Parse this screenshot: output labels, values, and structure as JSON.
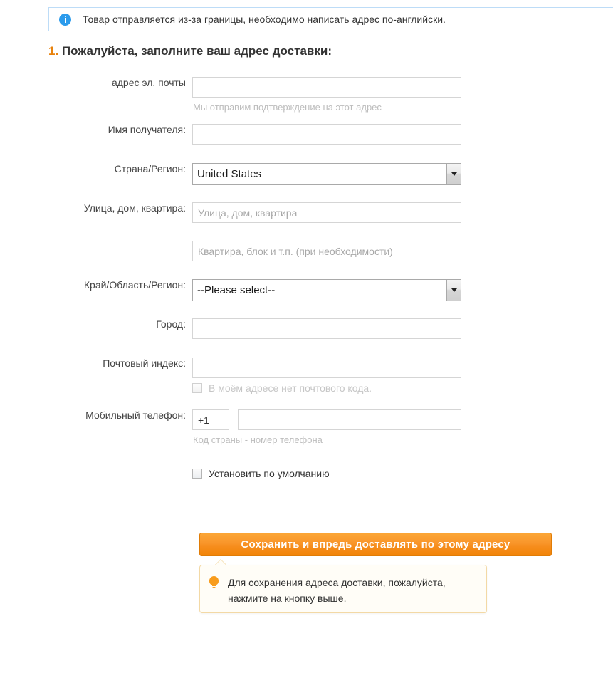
{
  "banner": {
    "icon": "info-circle-icon",
    "text": "Товар отправляется из-за границы, необходимо написать адрес по-английски."
  },
  "heading": {
    "number": "1.",
    "text": "Пожалуйста, заполните ваш адрес доставки:"
  },
  "form": {
    "email": {
      "label": "адрес эл. почты",
      "value": "",
      "placeholder": "",
      "hint": "Мы отправим подтверждение на этот адрес"
    },
    "recipient": {
      "label": "Имя получателя:",
      "value": "",
      "placeholder": ""
    },
    "country": {
      "label": "Страна/Регион:",
      "selected": "United States"
    },
    "street": {
      "label": "Улица, дом, квартира:",
      "value": "",
      "placeholder": "Улица, дом, квартира"
    },
    "street2": {
      "value": "",
      "placeholder": "Квартира, блок и т.п. (при необходимости)"
    },
    "state": {
      "label": "Край/Область/Регион:",
      "selected": "--Please select--"
    },
    "city": {
      "label": "Город:",
      "value": "",
      "placeholder": ""
    },
    "zip": {
      "label": "Почтовый индекс:",
      "value": "",
      "placeholder": "",
      "no_zip_label": "В моём адресе нет почтового кода.",
      "no_zip_checked": false,
      "no_zip_disabled": true
    },
    "phone": {
      "label": "Мобильный телефон:",
      "country_code": "+1",
      "number": "",
      "hint": "Код страны - номер телефона"
    },
    "default_address": {
      "label": "Установить по умолчанию",
      "checked": false
    }
  },
  "save_button": {
    "label": "Сохранить и впредь доставлять по этому адресу"
  },
  "tooltip": {
    "icon": "lightbulb-icon",
    "line1": "Для сохранения адреса доставки, пожалуйста,",
    "line2": "нажмите на кнопку выше."
  },
  "colors": {
    "accent_orange": "#f7941d",
    "info_blue": "#2b9bec",
    "banner_border": "#bddcf7",
    "tooltip_border": "#f3d9a5"
  }
}
